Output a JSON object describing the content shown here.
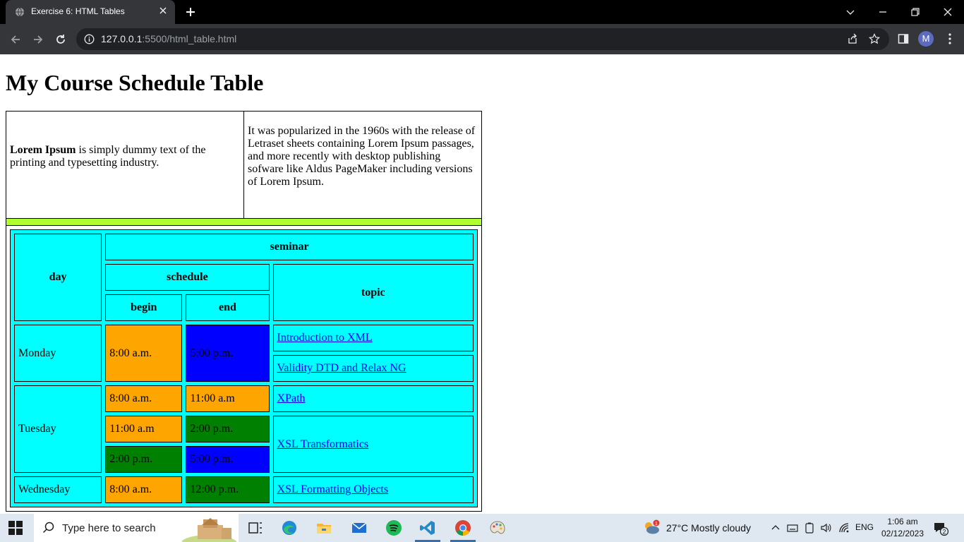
{
  "browser": {
    "tab_title": "Exercise 6: HTML Tables",
    "url_host": "127.0.0.1",
    "url_rest": ":5500/html_table.html",
    "profile_initial": "M"
  },
  "page": {
    "heading": "My Course Schedule Table",
    "intro_left_bold": "Lorem Ipsum",
    "intro_left_rest": " is simply dummy text of the printing and typesetting industry.",
    "intro_right": "It was popularized in the 1960s with the release of Letraset sheets containing Lorem Ipsum passages, and more recently with desktop publishing sofware like Aldus PageMaker including versions of Lorem Ipsum."
  },
  "schedule": {
    "headers": {
      "day": "day",
      "seminar": "seminar",
      "schedule": "schedule",
      "begin": "begin",
      "end": "end",
      "topic": "topic"
    },
    "monday": {
      "day": "Monday",
      "begin": "8:00 a.m.",
      "end": "5:00 p.m.",
      "topic1": "Introduction to XML",
      "topic2": "Validity DTD and Relax NG"
    },
    "tuesday": {
      "day": "Tuesday",
      "row1_begin": "8:00 a.m.",
      "row1_end": "11:00 a.m",
      "row1_topic": "XPath",
      "row2_begin": "11:00 a.m",
      "row2_end": "2:00 p.m.",
      "row3_begin": "2:00 p.m.",
      "row3_end": "5:00 p.m.",
      "row23_topic": "XSL Transformatics"
    },
    "wednesday": {
      "day": "Wednesday",
      "begin": "8:00 a.m.",
      "end": "12:00 p.m.",
      "topic": "XSL Formatting Objects"
    },
    "colors": {
      "cyan": "#00ffff",
      "orange": "#ffa500",
      "blue": "#0000ff",
      "green": "#008000",
      "greenbar": "#adff2f"
    }
  },
  "taskbar": {
    "search_placeholder": "Type here to search",
    "weather": "27°C  Mostly cloudy",
    "weather_badge": "1",
    "language": "ENG",
    "time": "1:06 am",
    "date": "02/12/2023",
    "notification_count": "2"
  }
}
